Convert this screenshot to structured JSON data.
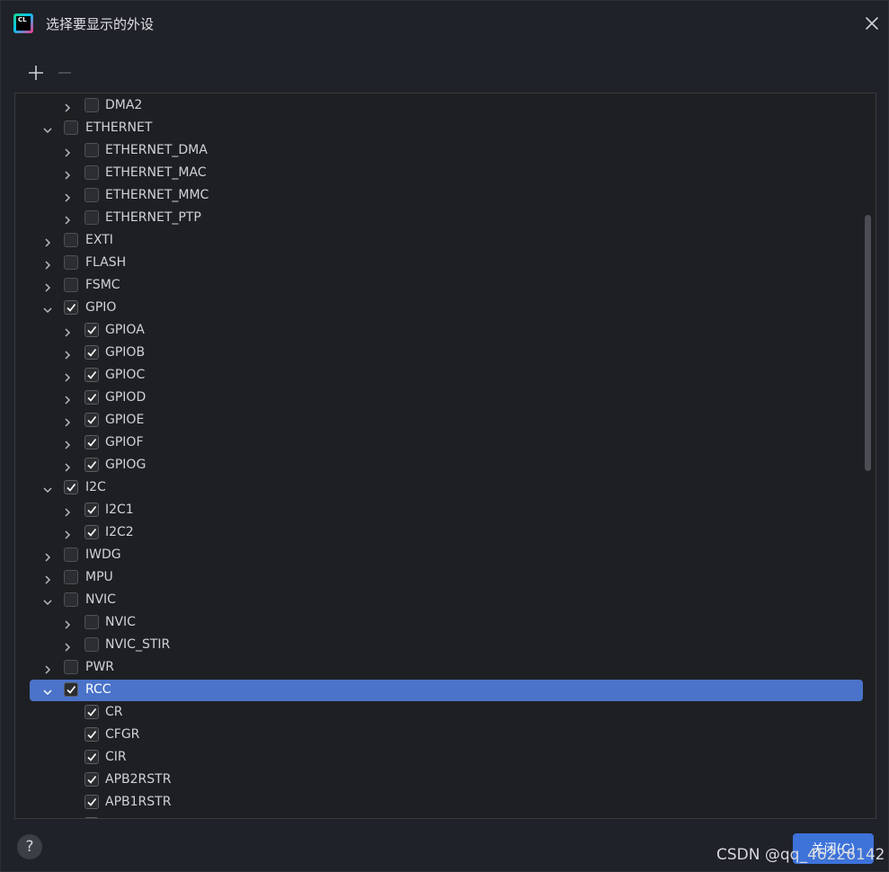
{
  "window": {
    "title": "选择要显示的外设",
    "app_icon_text": "CL"
  },
  "toolbar": {
    "add_symbol": "+",
    "remove_symbol": "—"
  },
  "tree": {
    "rows": [
      {
        "label": "DMA2",
        "depth": 1,
        "expandable": true,
        "expanded": false,
        "checked": false,
        "selected": false
      },
      {
        "label": "ETHERNET",
        "depth": 0,
        "expandable": true,
        "expanded": true,
        "checked": false,
        "selected": false
      },
      {
        "label": "ETHERNET_DMA",
        "depth": 1,
        "expandable": true,
        "expanded": false,
        "checked": false,
        "selected": false
      },
      {
        "label": "ETHERNET_MAC",
        "depth": 1,
        "expandable": true,
        "expanded": false,
        "checked": false,
        "selected": false
      },
      {
        "label": "ETHERNET_MMC",
        "depth": 1,
        "expandable": true,
        "expanded": false,
        "checked": false,
        "selected": false
      },
      {
        "label": "ETHERNET_PTP",
        "depth": 1,
        "expandable": true,
        "expanded": false,
        "checked": false,
        "selected": false
      },
      {
        "label": "EXTI",
        "depth": 0,
        "expandable": true,
        "expanded": false,
        "checked": false,
        "selected": false
      },
      {
        "label": "FLASH",
        "depth": 0,
        "expandable": true,
        "expanded": false,
        "checked": false,
        "selected": false
      },
      {
        "label": "FSMC",
        "depth": 0,
        "expandable": true,
        "expanded": false,
        "checked": false,
        "selected": false
      },
      {
        "label": "GPIO",
        "depth": 0,
        "expandable": true,
        "expanded": true,
        "checked": true,
        "selected": false
      },
      {
        "label": "GPIOA",
        "depth": 1,
        "expandable": true,
        "expanded": false,
        "checked": true,
        "selected": false
      },
      {
        "label": "GPIOB",
        "depth": 1,
        "expandable": true,
        "expanded": false,
        "checked": true,
        "selected": false
      },
      {
        "label": "GPIOC",
        "depth": 1,
        "expandable": true,
        "expanded": false,
        "checked": true,
        "selected": false
      },
      {
        "label": "GPIOD",
        "depth": 1,
        "expandable": true,
        "expanded": false,
        "checked": true,
        "selected": false
      },
      {
        "label": "GPIOE",
        "depth": 1,
        "expandable": true,
        "expanded": false,
        "checked": true,
        "selected": false
      },
      {
        "label": "GPIOF",
        "depth": 1,
        "expandable": true,
        "expanded": false,
        "checked": true,
        "selected": false
      },
      {
        "label": "GPIOG",
        "depth": 1,
        "expandable": true,
        "expanded": false,
        "checked": true,
        "selected": false
      },
      {
        "label": "I2C",
        "depth": 0,
        "expandable": true,
        "expanded": true,
        "checked": true,
        "selected": false
      },
      {
        "label": "I2C1",
        "depth": 1,
        "expandable": true,
        "expanded": false,
        "checked": true,
        "selected": false
      },
      {
        "label": "I2C2",
        "depth": 1,
        "expandable": true,
        "expanded": false,
        "checked": true,
        "selected": false
      },
      {
        "label": "IWDG",
        "depth": 0,
        "expandable": true,
        "expanded": false,
        "checked": false,
        "selected": false
      },
      {
        "label": "MPU",
        "depth": 0,
        "expandable": true,
        "expanded": false,
        "checked": false,
        "selected": false
      },
      {
        "label": "NVIC",
        "depth": 0,
        "expandable": true,
        "expanded": true,
        "checked": false,
        "selected": false
      },
      {
        "label": "NVIC",
        "depth": 1,
        "expandable": true,
        "expanded": false,
        "checked": false,
        "selected": false
      },
      {
        "label": "NVIC_STIR",
        "depth": 1,
        "expandable": true,
        "expanded": false,
        "checked": false,
        "selected": false
      },
      {
        "label": "PWR",
        "depth": 0,
        "expandable": true,
        "expanded": false,
        "checked": false,
        "selected": false
      },
      {
        "label": "RCC",
        "depth": 0,
        "expandable": true,
        "expanded": true,
        "checked": true,
        "selected": true
      },
      {
        "label": "CR",
        "depth": 1,
        "expandable": false,
        "expanded": false,
        "checked": true,
        "selected": false
      },
      {
        "label": "CFGR",
        "depth": 1,
        "expandable": false,
        "expanded": false,
        "checked": true,
        "selected": false
      },
      {
        "label": "CIR",
        "depth": 1,
        "expandable": false,
        "expanded": false,
        "checked": true,
        "selected": false
      },
      {
        "label": "APB2RSTR",
        "depth": 1,
        "expandable": false,
        "expanded": false,
        "checked": true,
        "selected": false
      },
      {
        "label": "APB1RSTR",
        "depth": 1,
        "expandable": false,
        "expanded": false,
        "checked": true,
        "selected": false
      },
      {
        "label": "",
        "depth": 1,
        "expandable": false,
        "expanded": false,
        "checked": true,
        "selected": false
      }
    ]
  },
  "footer": {
    "help_symbol": "?",
    "close_label": "关闭(C)"
  },
  "watermark": "CSDN @qq_46226142",
  "colors": {
    "background": "#1f2228",
    "selection": "#4a73c9",
    "primary_button": "#3d72d9"
  }
}
